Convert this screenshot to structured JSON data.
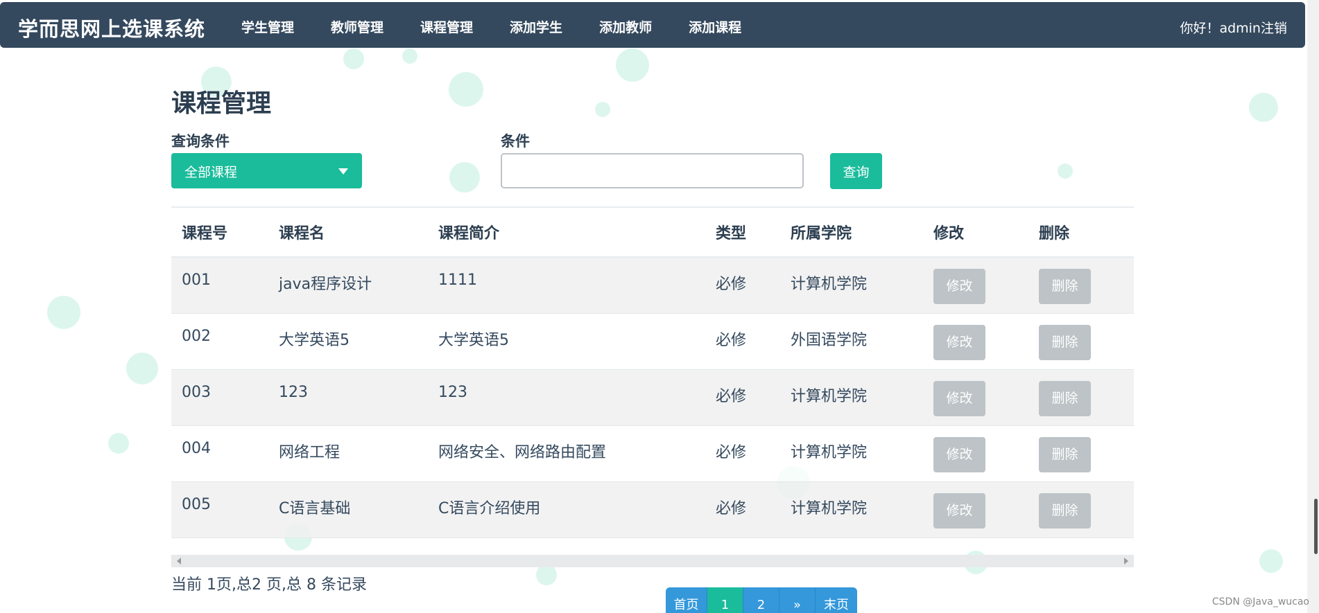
{
  "nav": {
    "brand": "学而思网上选课系统",
    "items": [
      "学生管理",
      "教师管理",
      "课程管理",
      "添加学生",
      "添加教师",
      "添加课程"
    ],
    "greeting": "你好！admin",
    "logout": "注销"
  },
  "page": {
    "title": "课程管理",
    "query_label": "查询条件",
    "query_select_value": "全部课程",
    "condition_label": "条件",
    "condition_value": "",
    "query_button": "查询"
  },
  "table": {
    "headers": [
      "课程号",
      "课程名",
      "课程简介",
      "类型",
      "所属学院",
      "修改",
      "删除"
    ],
    "rows": [
      {
        "id": "001",
        "name": "java程序设计",
        "intro": "1111",
        "type": "必修",
        "college": "计算机学院",
        "edit": "修改",
        "delete": "删除"
      },
      {
        "id": "002",
        "name": "大学英语5",
        "intro": "大学英语5",
        "type": "必修",
        "college": "外国语学院",
        "edit": "修改",
        "delete": "删除"
      },
      {
        "id": "003",
        "name": "123",
        "intro": "123",
        "type": "必修",
        "college": "计算机学院",
        "edit": "修改",
        "delete": "删除"
      },
      {
        "id": "004",
        "name": "网络工程",
        "intro": "网络安全、网络路由配置",
        "type": "必修",
        "college": "计算机学院",
        "edit": "修改",
        "delete": "删除"
      },
      {
        "id": "005",
        "name": "C语言基础",
        "intro": "C语言介绍使用",
        "type": "必修",
        "college": "计算机学院",
        "edit": "修改",
        "delete": "删除"
      }
    ]
  },
  "pagination": {
    "info": "当前 1页,总2 页,总 8 条记录",
    "first": "首页",
    "pages": [
      "1",
      "2"
    ],
    "current": "1",
    "next": "»",
    "last": "末页"
  },
  "watermark": "CSDN @Java_wucao",
  "colors": {
    "navbar": "#34495e",
    "accent": "#1abc9c",
    "pager": "#3498db",
    "disabled_button": "#bdc3c7"
  }
}
